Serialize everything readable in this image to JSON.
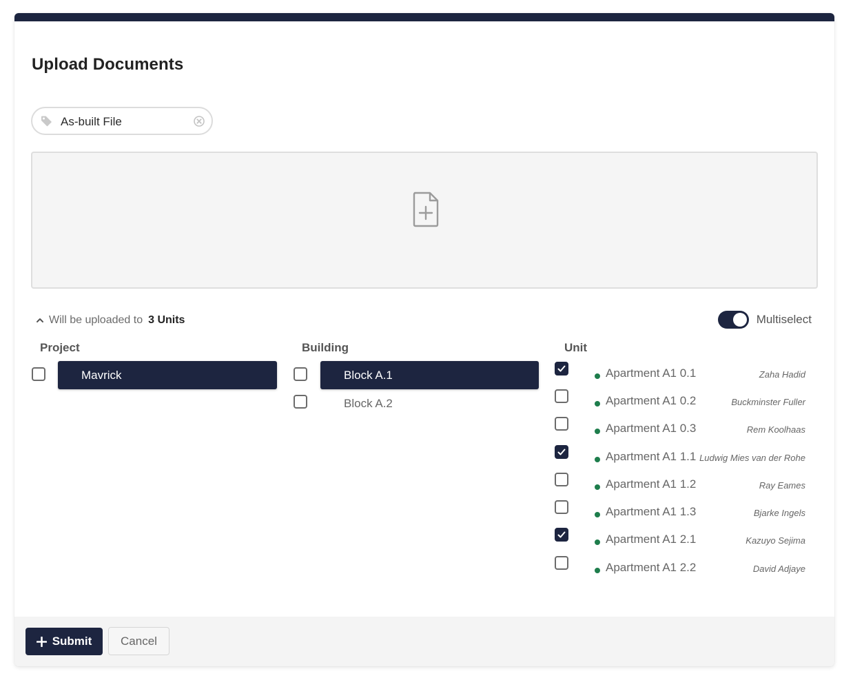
{
  "dialog": {
    "title": "Upload Documents"
  },
  "tag": {
    "icon": "tag-icon",
    "label": "As-built File",
    "clear_icon": "close-circle-icon"
  },
  "dropzone": {
    "icon": "file-plus-icon"
  },
  "summary": {
    "prefix": "Will be uploaded to",
    "count": "3 Units",
    "icon": "chevron-up-icon"
  },
  "multiselect": {
    "label": "Multiselect",
    "enabled": true
  },
  "columns": {
    "project": "Project",
    "building": "Building",
    "unit": "Unit"
  },
  "projects": [
    {
      "label": "Mavrick",
      "checked": false,
      "active": true
    }
  ],
  "buildings": [
    {
      "label": "Block A.1",
      "checked": false,
      "active": true
    },
    {
      "label": "Block A.2",
      "checked": false,
      "active": false
    }
  ],
  "units": [
    {
      "name": "Apartment A1 0.1",
      "architect": "Zaha Hadid",
      "checked": true
    },
    {
      "name": "Apartment A1 0.2",
      "architect": "Buckminster Fuller",
      "checked": false
    },
    {
      "name": "Apartment A1 0.3",
      "architect": "Rem Koolhaas",
      "checked": false
    },
    {
      "name": "Apartment A1 1.1",
      "architect": "Ludwig Mies van der Rohe",
      "checked": true
    },
    {
      "name": "Apartment A1 1.2",
      "architect": "Ray Eames",
      "checked": false
    },
    {
      "name": "Apartment A1 1.3",
      "architect": "Bjarke Ingels",
      "checked": false
    },
    {
      "name": "Apartment A1 2.1",
      "architect": "Kazuyo Sejima",
      "checked": true
    },
    {
      "name": "Apartment A1 2.2",
      "architect": "David Adjaye",
      "checked": false
    }
  ],
  "footer": {
    "submit_label": "Submit",
    "cancel_label": "Cancel"
  },
  "colors": {
    "navy": "#1d2540",
    "status_green": "#1e7d4c",
    "dropzone_bg": "#f5f5f5"
  }
}
